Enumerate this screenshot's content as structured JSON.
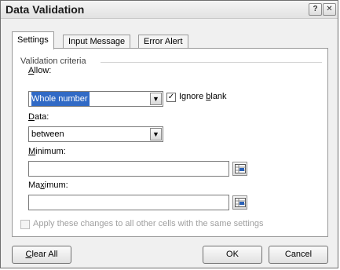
{
  "window": {
    "title": "Data Validation",
    "help_button": "?",
    "close_button": "✕"
  },
  "tabs": [
    {
      "label": "Settings",
      "active": true
    },
    {
      "label": "Input Message",
      "active": false
    },
    {
      "label": "Error Alert",
      "active": false
    }
  ],
  "validation_criteria": {
    "group_label": "Validation criteria",
    "allow": {
      "label_accel": "A",
      "label_rest": "llow:",
      "value": "Whole number"
    },
    "ignore_blank": {
      "label_pre": "Ignore ",
      "label_accel": "b",
      "label_rest": "lank",
      "checked": true
    },
    "data": {
      "label_accel": "D",
      "label_rest": "ata:",
      "value": "between"
    },
    "minimum": {
      "label_accel": "M",
      "label_rest": "inimum:",
      "value": ""
    },
    "maximum": {
      "label_pre": "Ma",
      "label_accel": "x",
      "label_rest": "imum:",
      "value": ""
    }
  },
  "apply_all": {
    "label": "Apply these changes to all other cells with the same settings",
    "checked": false,
    "enabled": false
  },
  "buttons": {
    "clear_all_accel": "C",
    "clear_all_rest": "lear All",
    "ok": "OK",
    "cancel": "Cancel"
  },
  "checkmark": "✓",
  "dropdown_glyph": "▼"
}
